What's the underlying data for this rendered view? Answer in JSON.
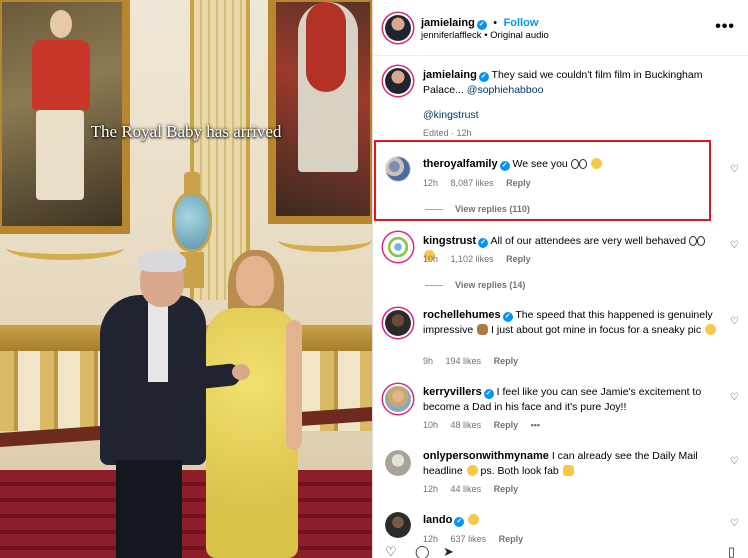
{
  "video": {
    "caption_overlay": "The Royal Baby has arrived"
  },
  "header": {
    "username": "jamielaing",
    "follow_label": "Follow",
    "collab": "jenniferlaffleck",
    "audio": "Original audio",
    "more_icon": "•••"
  },
  "post_caption": {
    "username": "jamielaing",
    "text": "They said we couldn't film film in Buckingham Palace...",
    "mention1": "@sophiehabboo",
    "mention2": "@kingstrust",
    "edited": "Edited · 12h"
  },
  "comments": [
    {
      "username": "theroyalfamily",
      "text": "We see you",
      "time": "12h",
      "likes": "8,087 likes",
      "reply": "Reply",
      "view_replies": "View replies (110)"
    },
    {
      "username": "kingstrust",
      "text": "All of our attendees are very well behaved",
      "time": "10h",
      "likes": "1,102 likes",
      "reply": "Reply",
      "view_replies": "View replies (14)"
    },
    {
      "username": "rochellehumes",
      "text": "The speed that this happened is genuinely impressive",
      "text2": "I just about got mine in focus for a sneaky pic",
      "time": "9h",
      "likes": "194 likes",
      "reply": "Reply"
    },
    {
      "username": "kerryvillers",
      "text": "I feel like you can see Jamie's excitement to become a Dad in his face and it's pure Joy!!",
      "time": "10h",
      "likes": "48 likes",
      "reply": "Reply",
      "more": "•••"
    },
    {
      "username": "onlypersonwithmyname",
      "text": "I can already see the Daily Mail headline",
      "text2": "ps. Both look fab",
      "time": "12h",
      "likes": "44 likes",
      "reply": "Reply"
    },
    {
      "username": "lando",
      "text": "",
      "time": "12h",
      "likes": "637 likes",
      "reply": "Reply"
    }
  ],
  "icons": {
    "heart": "♡",
    "verified": "✓"
  },
  "colors": {
    "link": "#0095f6",
    "highlight": "#e0181e",
    "meta": "#737373"
  }
}
